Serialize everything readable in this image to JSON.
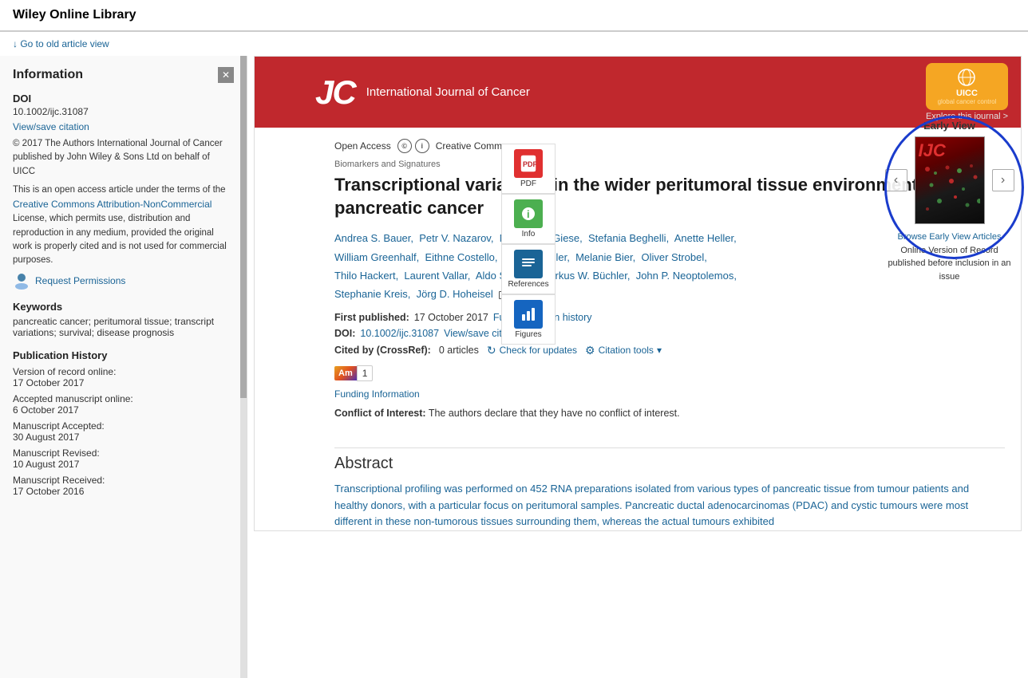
{
  "site_title": "Wiley Online Library",
  "old_article_link": "↓ Go to old article view",
  "journal": {
    "name": "International Journal of Cancer",
    "logo_letters": "JC",
    "explore_link": "Explore this journal >",
    "uicc_text": "UICC",
    "uicc_sub": "global cancer control"
  },
  "tools": {
    "pdf_label": "PDF",
    "info_label": "Info",
    "references_label": "References",
    "figures_label": "Figures"
  },
  "article": {
    "open_access_label": "Open Access",
    "cc_label": "Creative Commons",
    "section_tag": "Biomarkers and Signatures",
    "title": "Transcriptional variations in the wider peritumoral tissue environment of pancreatic cancer",
    "authors": [
      "Andrea S. Bauer",
      "Petr V. Nazarov",
      "Nathalia A. Giese",
      "Stefania Beghelli",
      "Anette Heller",
      "William Greenhalf",
      "Eithne Costello",
      "Arnaud Muller",
      "Melanie Bier",
      "Oliver Strobel",
      "Thilo Hackert",
      "Laurent Vallar",
      "Aldo Scarpa",
      "Markus W. Büchler",
      "John P. Neoptolemos",
      "Stephanie Kreis",
      "Jörg D. Hoheisel"
    ],
    "first_published_label": "First published:",
    "first_published_date": "17 October 2017",
    "full_pub_history_link": "Full publication history",
    "doi_label": "DOI:",
    "doi_value": "10.1002/ijc.31087",
    "view_save_citation_link": "View/save citation",
    "cited_by_label": "Cited by (CrossRef):",
    "cited_by_count": "0 articles",
    "check_for_updates": "Check for updates",
    "citation_tools": "Citation tools",
    "altmetric_score": "1",
    "funding_information": "Funding Information",
    "conflict_label": "Conflict of Interest:",
    "conflict_text": "The authors declare that they have no conflict of interest.",
    "abstract_title": "Abstract",
    "abstract_text": "Transcriptional profiling was performed on 452 RNA preparations isolated from various types of pancreatic tissue from tumour patients and healthy donors, with a particular focus on peritumoral samples. Pancreatic ductal adenocarcinomas (PDAC) and cystic tumours were most different in these non-tumorous tissues surrounding them, whereas the actual tumours exhibited"
  },
  "early_view": {
    "label": "Early View",
    "browse_link": "Browse Early View Articles",
    "description": "Online Version of Record published before inclusion in an issue"
  },
  "sidebar": {
    "title": "Information",
    "doi_label": "DOI",
    "doi_value": "10.1002/ijc.31087",
    "view_save_citation": "View/save citation",
    "copyright": "© 2017 The Authors International Journal of Cancer published by John Wiley & Sons Ltd on behalf of UICC",
    "license_text": "This is an open access article under the terms of the",
    "license_link": "Creative Commons Attribution-NonCommercial",
    "license_text2": "License, which permits use, distribution and reproduction in any medium, provided the original work is properly cited and is not used for commercial purposes.",
    "request_permissions": "Request Permissions",
    "keywords_label": "Keywords",
    "keywords_text": "pancreatic cancer; peritumoral tissue; transcript variations; survival; disease prognosis",
    "pub_history_label": "Publication History",
    "pub_history": [
      {
        "label": "Version of record online:",
        "date": "17 October 2017"
      },
      {
        "label": "Accepted manuscript online:",
        "date": "6 October 2017"
      },
      {
        "label": "Manuscript Accepted:",
        "date": "30 August 2017"
      },
      {
        "label": "Manuscript Revised:",
        "date": "10 August 2017"
      },
      {
        "label": "Manuscript Received:",
        "date": "17 October 2016"
      }
    ]
  }
}
